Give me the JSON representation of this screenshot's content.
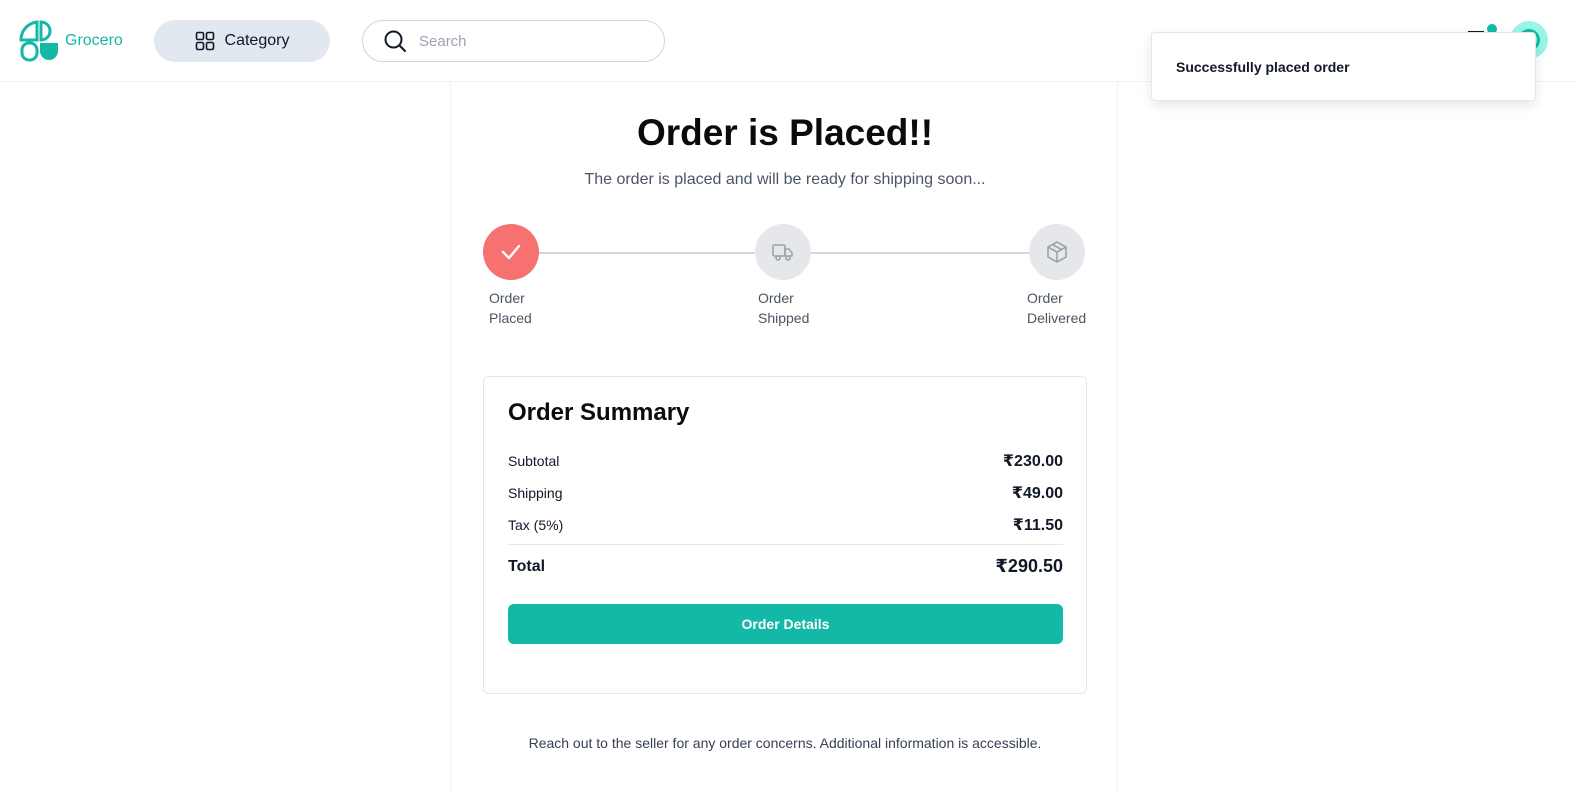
{
  "app": {
    "logo_text": "Grocero",
    "accent_color": "#14b8a6"
  },
  "header": {
    "category_label": "Category",
    "category_icon": "grid-icon",
    "search_placeholder": "Search",
    "search_value": "",
    "search_icon": "search-icon",
    "menu_icon": "menu-icon",
    "avatar_icon": "user-avatar"
  },
  "toast": {
    "message": "Successfully placed order"
  },
  "order": {
    "title": "Order is Placed!!",
    "subtitle": "The order is placed and will be ready for shipping soon...",
    "steps": [
      {
        "line1": "Order",
        "line2": "Placed",
        "status": "done",
        "icon": "check-icon",
        "color": "#f87171"
      },
      {
        "line1": "Order",
        "line2": "Shipped",
        "status": "pending",
        "icon": "truck-icon",
        "color": "#e5e7eb"
      },
      {
        "line1": "Order",
        "line2": "Delivered",
        "status": "pending",
        "icon": "package-icon",
        "color": "#e5e7eb"
      }
    ]
  },
  "summary": {
    "title": "Order Summary",
    "rows": [
      {
        "label": "Subtotal",
        "value": "₹230.00"
      },
      {
        "label": "Shipping",
        "value": "₹49.00"
      },
      {
        "label": "Tax (5%)",
        "value": "₹11.50"
      }
    ],
    "total_label": "Total",
    "total_value": "₹290.50",
    "button_label": "Order Details"
  },
  "footer_note": "Reach out to the seller for any order concerns. Additional information is accessible."
}
